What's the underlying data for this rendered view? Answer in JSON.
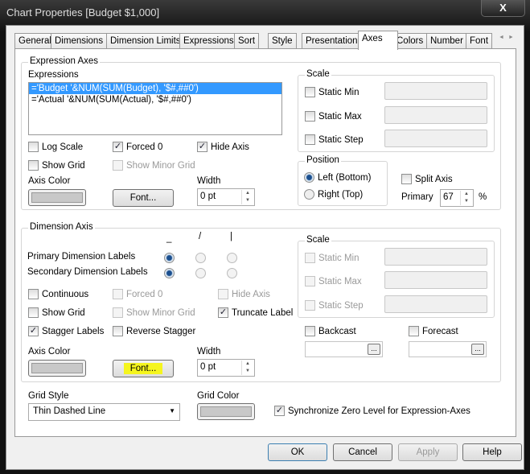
{
  "window": {
    "title": "Chart Properties [Budget $1,000]",
    "close": "X"
  },
  "tabs": [
    "General",
    "Dimensions",
    "Dimension Limits",
    "Expressions",
    "Sort",
    "Style",
    "Presentation",
    "Axes",
    "Colors",
    "Number",
    "Font"
  ],
  "tab_scroll": {
    "left": "◄",
    "right": "►"
  },
  "expression_axes": {
    "legend": "Expression Axes",
    "expressions_label": "Expressions",
    "expressions": [
      "='Budget '&NUM(SUM(Budget), '$#,##0')",
      "='Actual '&NUM(SUM(Actual), '$#,##0')"
    ],
    "log_scale": "Log Scale",
    "forced0": "Forced 0",
    "hide_axis": "Hide Axis",
    "show_grid": "Show Grid",
    "show_minor_grid": "Show Minor Grid",
    "axis_color": "Axis Color",
    "font": "Font...",
    "width_label": "Width",
    "width": "0 pt",
    "scale": {
      "legend": "Scale",
      "static_min": "Static Min",
      "static_max": "Static Max",
      "static_step": "Static Step"
    },
    "position": {
      "legend": "Position",
      "left": "Left (Bottom)",
      "right": "Right (Top)"
    },
    "split_axis": "Split Axis",
    "primary_label": "Primary",
    "primary": "67",
    "percent": "%"
  },
  "dimension_axis": {
    "legend": "Dimension Axis",
    "orient": [
      "_",
      "/",
      "|"
    ],
    "primary_labels": "Primary Dimension Labels",
    "secondary_labels": "Secondary Dimension Labels",
    "continuous": "Continuous",
    "forced0": "Forced 0",
    "hide_axis": "Hide Axis",
    "show_grid": "Show Grid",
    "show_minor_grid": "Show Minor Grid",
    "truncate": "Truncate Label",
    "stagger": "Stagger Labels",
    "reverse_stagger": "Reverse Stagger",
    "axis_color": "Axis Color",
    "font": "Font...",
    "width_label": "Width",
    "width": "0 pt",
    "scale": {
      "legend": "Scale",
      "static_min": "Static Min",
      "static_max": "Static Max",
      "static_step": "Static Step"
    },
    "backcast": "Backcast",
    "forecast": "Forecast",
    "dots": "..."
  },
  "grid_style_label": "Grid Style",
  "grid_style": "Thin Dashed Line",
  "grid_color": "Grid Color",
  "sync_zero": "Synchronize Zero Level for Expression-Axes",
  "check": "✓",
  "buttons": {
    "ok": "OK",
    "cancel": "Cancel",
    "apply": "Apply",
    "help": "Help"
  }
}
